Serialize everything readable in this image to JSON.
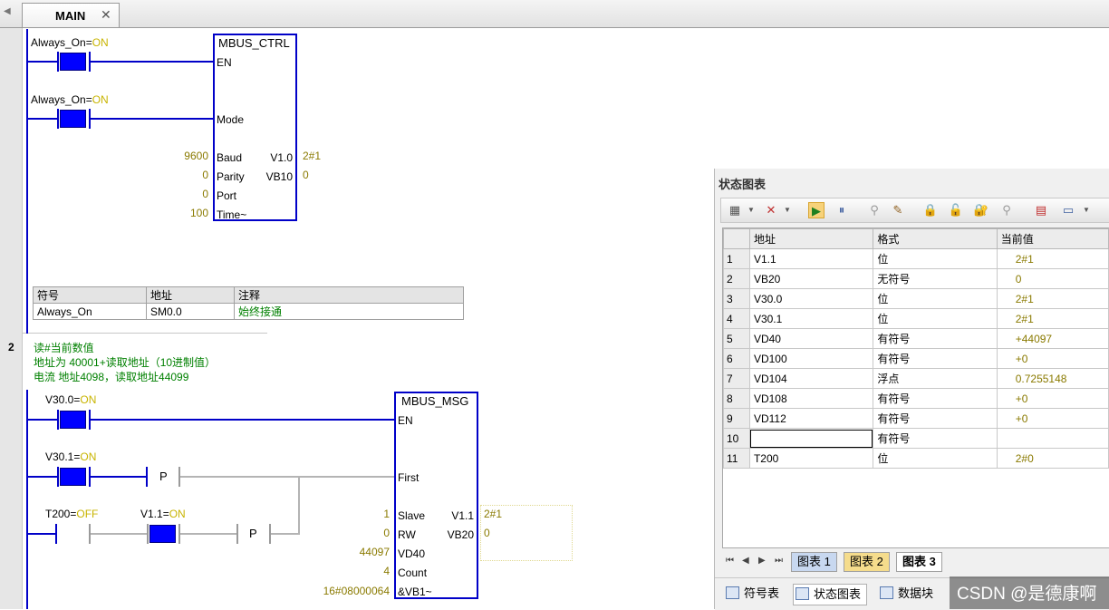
{
  "tab": {
    "label": "MAIN",
    "close": "✕"
  },
  "rung1": {
    "contact1": {
      "name": "Always_On",
      "eq": "=",
      "state": "ON"
    },
    "contact2": {
      "name": "Always_On",
      "eq": "=",
      "state": "ON"
    },
    "block": {
      "title": "MBUS_CTRL",
      "pins": {
        "en": "EN",
        "mode": "Mode",
        "baud": "Baud",
        "parity": "Parity",
        "port": "Port",
        "time": "Time~",
        "done": "V1.0",
        "error": "VB10"
      },
      "inputs": {
        "baud": "9600",
        "parity": "0",
        "port": "0",
        "time": "100"
      },
      "outputs": {
        "done": "2#1",
        "error": "0"
      }
    },
    "symtable": {
      "headers": [
        "符号",
        "地址",
        "注释"
      ],
      "row": [
        "Always_On",
        "SM0.0",
        "始终接通"
      ]
    }
  },
  "rung2": {
    "number": "2",
    "comment": [
      "读#当前数值",
      "地址为 40001+读取地址（10进制值）",
      "电流 地址4098，读取地址44099"
    ],
    "contact1": {
      "name": "V30.0",
      "eq": "=",
      "state": "ON"
    },
    "contact2": {
      "name": "V30.1",
      "eq": "=",
      "state": "ON"
    },
    "contact3": {
      "name": "T200",
      "eq": "=",
      "state": "OFF"
    },
    "contact4": {
      "name": "V1.1",
      "eq": "=",
      "state": "ON"
    },
    "p_label": "P",
    "block": {
      "title": "MBUS_MSG",
      "pins": {
        "en": "EN",
        "first": "First",
        "slave": "Slave",
        "rw": "RW",
        "addr": "VD40",
        "count": "Count",
        "ptr": "&VB1~",
        "done": "V1.1",
        "error": "VB20"
      },
      "inputs": {
        "slave": "1",
        "rw": "0",
        "addr": "44097",
        "count": "4",
        "ptr": "16#08000064"
      },
      "outputs": {
        "done": "2#1",
        "error": "0"
      }
    }
  },
  "panel": {
    "title": "状态图表",
    "columns": [
      "",
      "地址",
      "格式",
      "当前值"
    ],
    "rows": [
      {
        "n": "1",
        "addr": "V1.1",
        "fmt": "位",
        "val": "2#1"
      },
      {
        "n": "2",
        "addr": "VB20",
        "fmt": "无符号",
        "val": "0"
      },
      {
        "n": "3",
        "addr": "V30.0",
        "fmt": "位",
        "val": "2#1"
      },
      {
        "n": "4",
        "addr": "V30.1",
        "fmt": "位",
        "val": "2#1"
      },
      {
        "n": "5",
        "addr": "VD40",
        "fmt": "有符号",
        "val": "+44097"
      },
      {
        "n": "6",
        "addr": "VD100",
        "fmt": "有符号",
        "val": "+0"
      },
      {
        "n": "7",
        "addr": "VD104",
        "fmt": "浮点",
        "val": "0.7255148"
      },
      {
        "n": "8",
        "addr": "VD108",
        "fmt": "有符号",
        "val": "+0"
      },
      {
        "n": "9",
        "addr": "VD112",
        "fmt": "有符号",
        "val": "+0"
      },
      {
        "n": "10",
        "addr": "",
        "fmt": "有符号",
        "val": ""
      },
      {
        "n": "11",
        "addr": "T200",
        "fmt": "位",
        "val": "2#0"
      }
    ],
    "sheet_tabs": [
      "图表 1",
      "图表 2",
      "图表 3"
    ],
    "bottom_tabs": [
      "符号表",
      "状态图表",
      "数据块"
    ]
  },
  "watermark": "CSDN @是德康啊",
  "colors": {
    "wire": "#0000c8",
    "contact": "#0000ff",
    "value": "#8a7a00",
    "state": "#c8b400",
    "comment": "#008000"
  }
}
